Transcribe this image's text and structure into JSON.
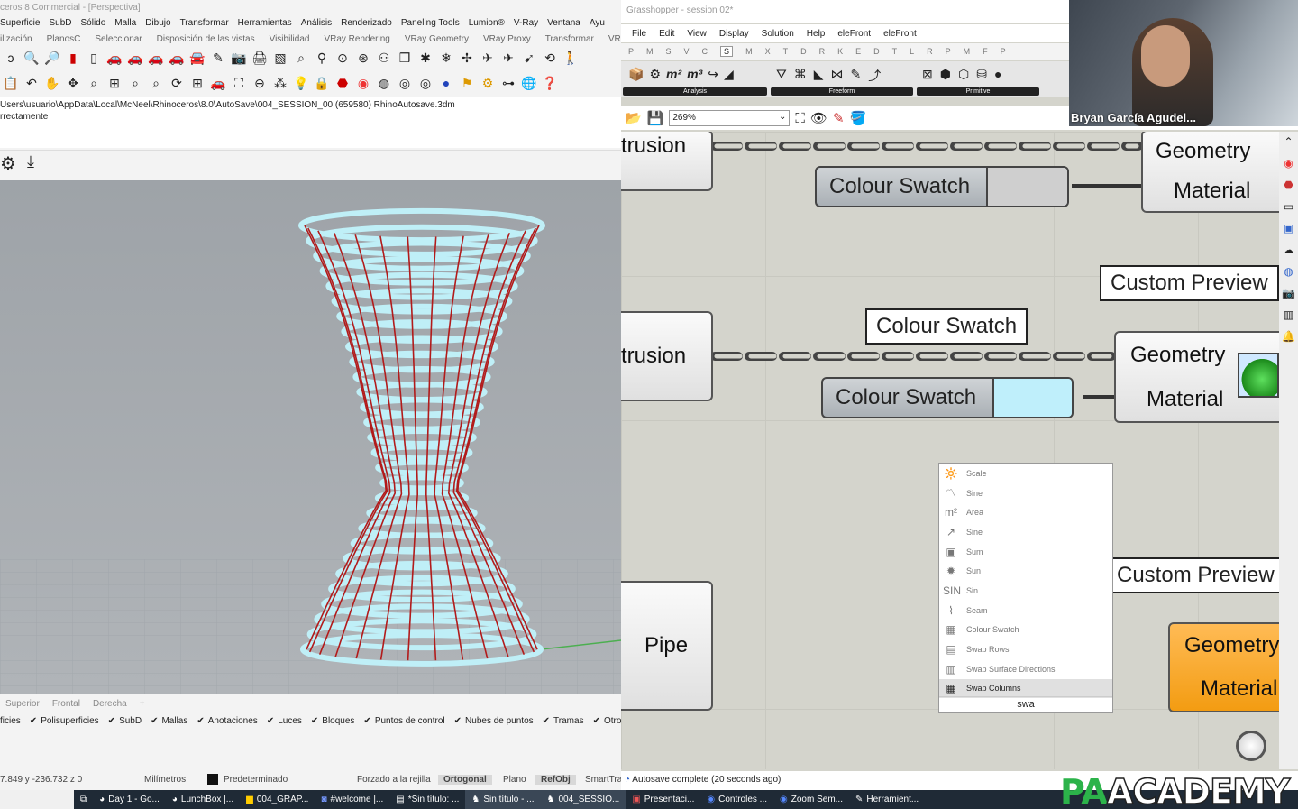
{
  "rhino": {
    "title": "ceros 8 Commercial - [Perspectiva]",
    "menu": [
      "Superficie",
      "SubD",
      "Sólido",
      "Malla",
      "Dibujo",
      "Transformar",
      "Herramientas",
      "Análisis",
      "Renderizado",
      "Paneling Tools",
      "Lumion®",
      "V-Ray",
      "Ventana",
      "Ayu"
    ],
    "tabs": [
      "ilización",
      "PlanosC",
      "Seleccionar",
      "Disposición de las vistas",
      "Visibilidad",
      "VRay Rendering",
      "VRay Geometry",
      "VRay Proxy",
      "Transformar",
      "VRay"
    ],
    "command_lines": [
      "Users\\usuario\\AppData\\Local\\McNeel\\Rhinoceros\\8.0\\AutoSave\\004_SESSION_00 (659580) RhinoAutosave.3dm",
      "rrectamente"
    ],
    "viewport_tabs": [
      "Superior",
      "Frontal",
      "Derecha",
      "+"
    ],
    "osnaps": [
      "ficies",
      "Polisuperficies",
      "SubD",
      "Mallas",
      "Anotaciones",
      "Luces",
      "Bloques",
      "Puntos de control",
      "Nubes de puntos",
      "Tramas",
      "Otro"
    ],
    "status": {
      "coords": "7.849  y -236.732  z 0",
      "units": "Milímetros",
      "layer": "Predeterminado",
      "grid": "Forzado a la rejilla",
      "ortho": "Ortogonal",
      "plano": "Plano",
      "refobj": "RefObj",
      "smart": "SmartTra"
    }
  },
  "grasshopper": {
    "title": "Grasshopper - session 02*",
    "menu": [
      "File",
      "Edit",
      "View",
      "Display",
      "Solution",
      "Help",
      "eleFront",
      "eleFront"
    ],
    "tabs": [
      "P",
      "M",
      "S",
      "V",
      "C",
      "S",
      "M",
      "X",
      "T",
      "D",
      "R",
      "K",
      "E",
      "D",
      "T",
      "L",
      "R",
      "P",
      "M",
      "F",
      "P"
    ],
    "active_tab_index": 5,
    "ribbon_groups": [
      "Analysis",
      "Freeform",
      "Primitive"
    ],
    "zoom": "269%",
    "components": {
      "extrusion_1": "trusion",
      "extrusion_2": "trusion",
      "pipe": "Pipe",
      "geometry": "Geometry",
      "material": "Material",
      "colour_swatch": "Colour Swatch",
      "custom_preview": "Custom Preview"
    },
    "search_results": [
      {
        "icon": "🔆",
        "label": "Scale"
      },
      {
        "icon": "〽",
        "label": "Sine"
      },
      {
        "icon": "m²",
        "label": "Area"
      },
      {
        "icon": "↗",
        "label": "Sine"
      },
      {
        "icon": "▣",
        "label": "Sum"
      },
      {
        "icon": "✹",
        "label": "Sun"
      },
      {
        "icon": "SIN",
        "label": "Sin"
      },
      {
        "icon": "⌇",
        "label": "Seam"
      },
      {
        "icon": "▦",
        "label": "Colour Swatch"
      },
      {
        "icon": "▤",
        "label": "Swap Rows"
      },
      {
        "icon": "▥",
        "label": "Swap Surface Directions"
      },
      {
        "icon": "▦",
        "label": "Swap Columns"
      }
    ],
    "search_query": "swa",
    "status": "Autosave complete (20 seconds ago)"
  },
  "webcam": {
    "name": "Bryan García Agudel..."
  },
  "taskbar": [
    "Day 1 - Go...",
    "LunchBox |...",
    "004_GRAP...",
    "#welcome |...",
    "*Sin título: ...",
    "Sin título - ...",
    "004_SESSIO...",
    "Presentaci...",
    "Controles ...",
    "Zoom Sem...",
    "Herramient..."
  ],
  "logo": {
    "pa": "PA",
    "academy": "ACADEMY"
  }
}
